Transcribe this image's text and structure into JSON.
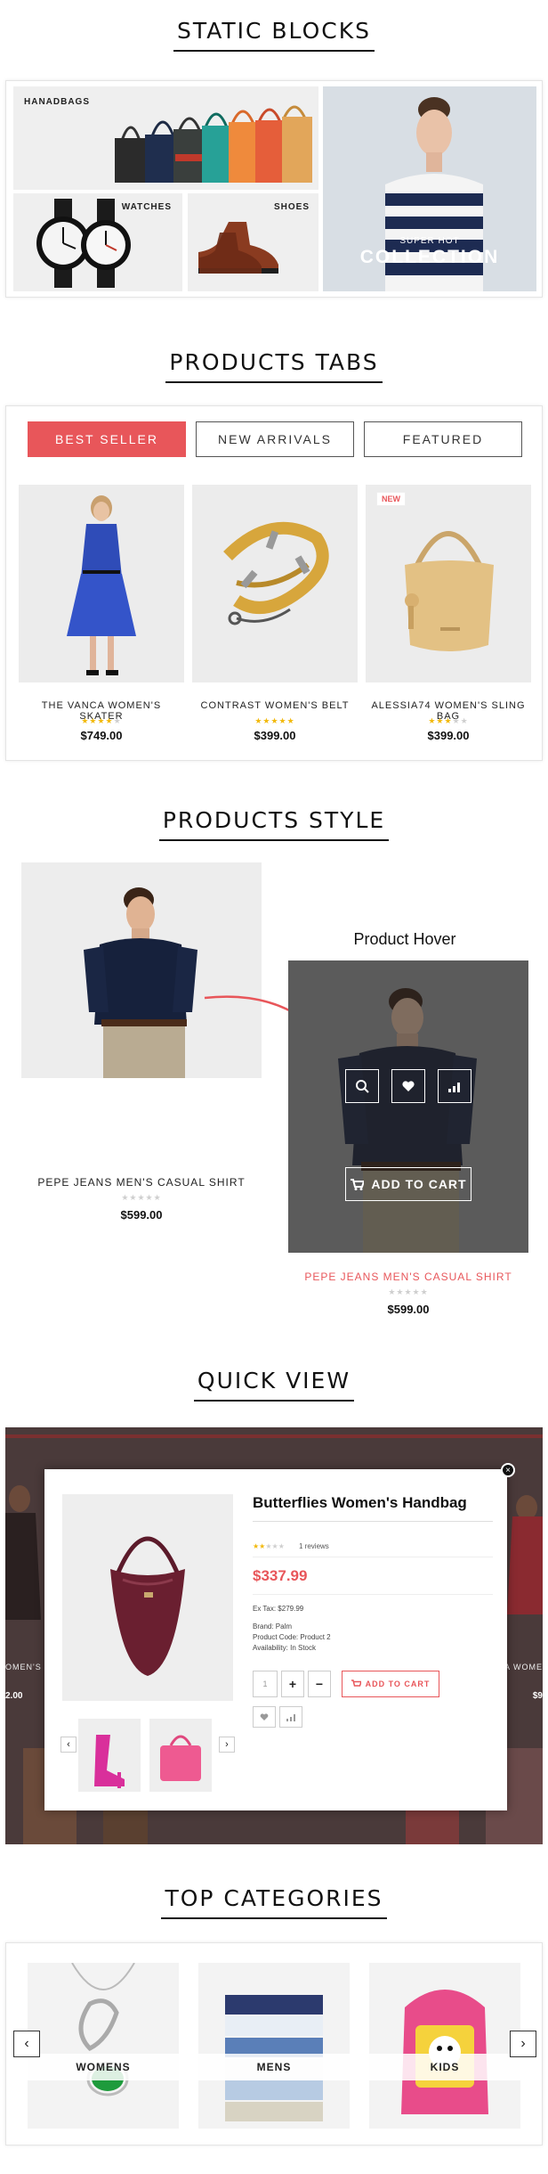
{
  "static_blocks": {
    "title": "STATIC BLOCKS",
    "handbags_label": "HANADBAGS",
    "watches_label": "WATCHES",
    "shoes_label": "SHOES",
    "promo_small": "SUPER HOT",
    "promo_big": "COLLECTION"
  },
  "product_tabs": {
    "title": "PRODUCTS TABS",
    "tabs": [
      {
        "label": "BEST SELLER",
        "active": true
      },
      {
        "label": "NEW ARRIVALS",
        "active": false
      },
      {
        "label": "FEATURED",
        "active": false
      }
    ],
    "new_badge": "NEW",
    "products": [
      {
        "name": "THE VANCA WOMEN'S SKATER",
        "price": "$749.00",
        "rating": 4
      },
      {
        "name": "CONTRAST WOMEN'S BELT",
        "price": "$399.00",
        "rating": 5
      },
      {
        "name": "ALESSIA74 WOMEN'S SLING BAG",
        "price": "$399.00",
        "rating": 3
      }
    ]
  },
  "products_style": {
    "title": "PRODUCTS STYLE",
    "hover_caption": "Product Hover",
    "add_to_cart": "ADD TO CART",
    "product_name": "PEPE JEANS MEN'S CASUAL SHIRT",
    "price": "$599.00",
    "rating": 0,
    "hover_icons": [
      "search-icon",
      "heart-icon",
      "compare-icon",
      "cart-icon"
    ]
  },
  "quick_view": {
    "title": "QUICK VIEW",
    "product_title": "Butterflies Women's Handbag",
    "reviews": "1 reviews",
    "rating": 2,
    "price": "$337.99",
    "ex_tax": "Ex Tax: $279.99",
    "brand": "Brand: Palm",
    "product_code": "Product Code: Product 2",
    "availability": "Availability: In Stock",
    "quantity": "1",
    "add_to_cart": "ADD TO CART",
    "bg_left_name": "OMEN'S D",
    "bg_left_price": "2.00",
    "bg_right_name": "A WOME",
    "bg_right_price": "$9"
  },
  "top_categories": {
    "title": "TOP CATEGORIES",
    "categories": [
      {
        "label": "WOMENS"
      },
      {
        "label": "MENS"
      },
      {
        "label": "KIDS"
      }
    ]
  },
  "colors": {
    "accent": "#e8565a",
    "star": "#f2b90c",
    "hover_overlay": "#555555"
  }
}
